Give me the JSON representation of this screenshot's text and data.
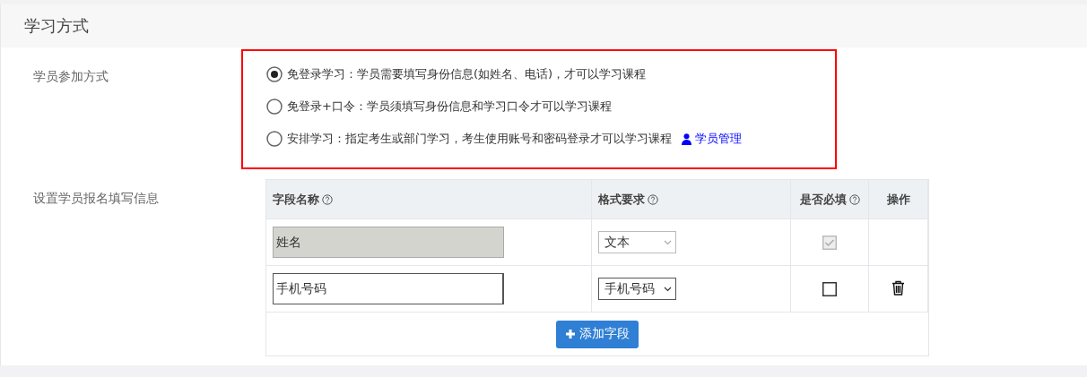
{
  "section": {
    "title": "学习方式"
  },
  "join_mode": {
    "label": "学员参加方式",
    "options": [
      {
        "text": "免登录学习：学员需要填写身份信息(如姓名、电话)，才可以学习课程",
        "selected": true
      },
      {
        "text": "免登录+口令：学员须填写身份信息和学习口令才可以学习课程",
        "selected": false
      },
      {
        "text": "安排学习：指定考生或部门学习，考生使用账号和密码登录才可以学习课程",
        "selected": false,
        "link": "学员管理"
      }
    ]
  },
  "fields": {
    "label": "设置学员报名填写信息",
    "columns": [
      {
        "label": "字段名称",
        "help": true
      },
      {
        "label": "格式要求",
        "help": true
      },
      {
        "label": "是否必填",
        "help": true
      },
      {
        "label": "操作",
        "help": false
      }
    ],
    "rows": [
      {
        "name": "姓名",
        "disabled": true,
        "format": "文本",
        "required": true,
        "deletable": false
      },
      {
        "name": "手机号码",
        "disabled": false,
        "format": "手机号码",
        "required": false,
        "deletable": true
      }
    ],
    "add_button": "添加字段"
  }
}
